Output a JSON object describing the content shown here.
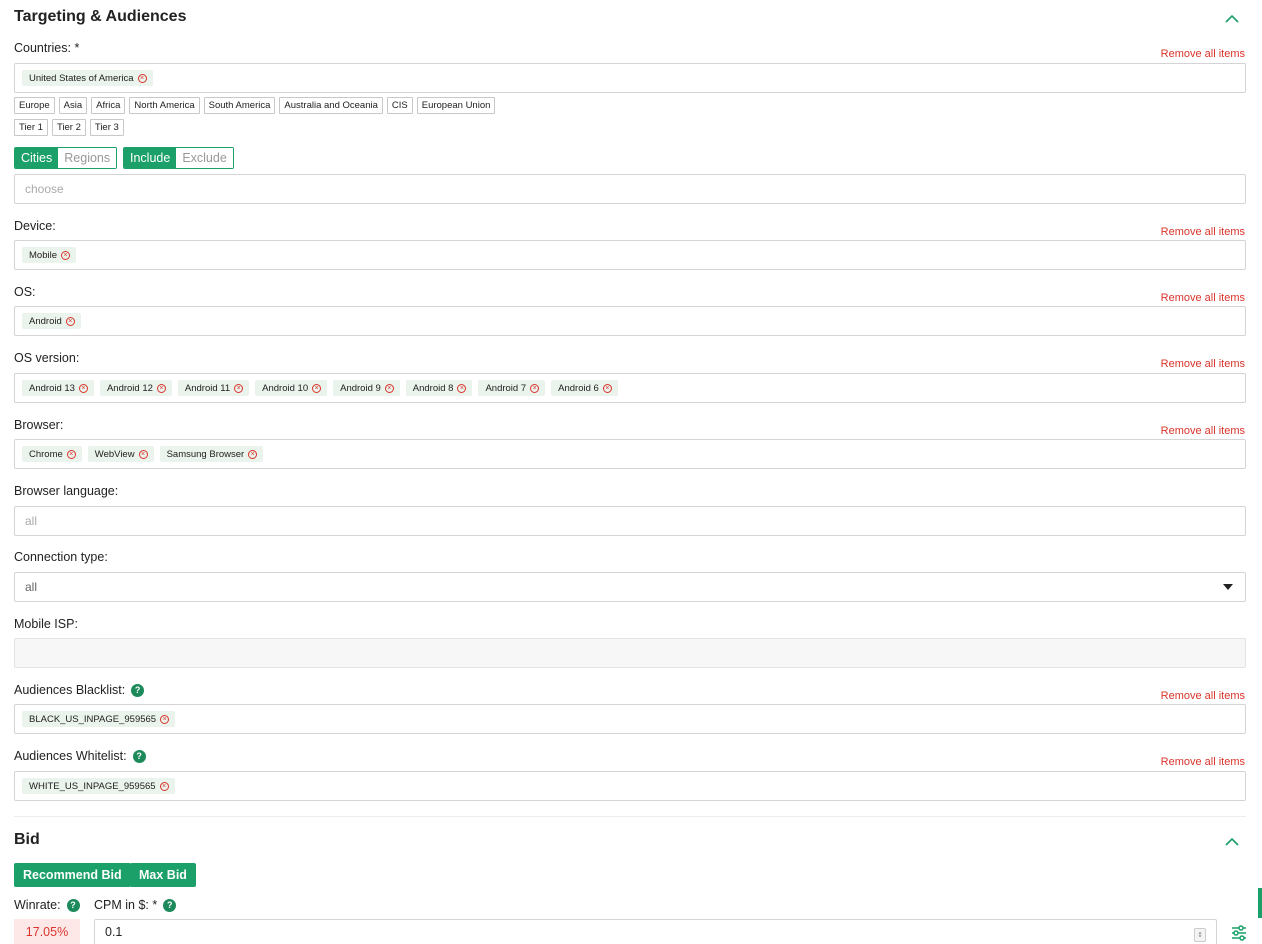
{
  "targeting": {
    "title": "Targeting & Audiences",
    "remove_all": "Remove all items",
    "countries": {
      "label": "Countries: *",
      "tags": [
        "United States of America"
      ],
      "regions_row1": [
        "Europe",
        "Asia",
        "Africa",
        "North America",
        "South America",
        "Australia and Oceania",
        "CIS",
        "European Union"
      ],
      "regions_row2": [
        "Tier 1",
        "Tier 2",
        "Tier 3"
      ]
    },
    "cities_toggle": {
      "cities": "Cities",
      "regions": "Regions",
      "include": "Include",
      "exclude": "Exclude"
    },
    "cities_input": {
      "placeholder": "choose"
    },
    "device": {
      "label": "Device:",
      "tags": [
        "Mobile"
      ]
    },
    "os": {
      "label": "OS:",
      "tags": [
        "Android"
      ]
    },
    "os_version": {
      "label": "OS version:",
      "tags": [
        "Android 13",
        "Android 12",
        "Android 11",
        "Android 10",
        "Android 9",
        "Android 8",
        "Android 7",
        "Android 6"
      ]
    },
    "browser": {
      "label": "Browser:",
      "tags": [
        "Chrome",
        "WebView",
        "Samsung Browser"
      ]
    },
    "browser_language": {
      "label": "Browser language:",
      "placeholder": "all"
    },
    "connection_type": {
      "label": "Connection type:",
      "value": "all"
    },
    "mobile_isp": {
      "label": "Mobile ISP:"
    },
    "audiences_blacklist": {
      "label": "Audiences Blacklist:",
      "tags": [
        "BLACK_US_INPAGE_959565"
      ]
    },
    "audiences_whitelist": {
      "label": "Audiences Whitelist:",
      "tags": [
        "WHITE_US_INPAGE_959565"
      ]
    }
  },
  "bid": {
    "title": "Bid",
    "recommend_button": "Recommend Bid",
    "max_button": "Max Bid",
    "winrate_label": "Winrate:",
    "winrate_value": "17.05%",
    "cpm_label": "CPM in $: *",
    "cpm_value": "0.1"
  },
  "icons": {
    "collapse": "chevron-up-icon",
    "remove_tag": "close-circle-icon",
    "help": "question-icon",
    "dropdown": "caret-down-icon",
    "settings": "sliders-icon"
  },
  "colors": {
    "accent": "#1aa068",
    "danger": "#d9342b",
    "winrate_bg": "#fde7e7"
  }
}
